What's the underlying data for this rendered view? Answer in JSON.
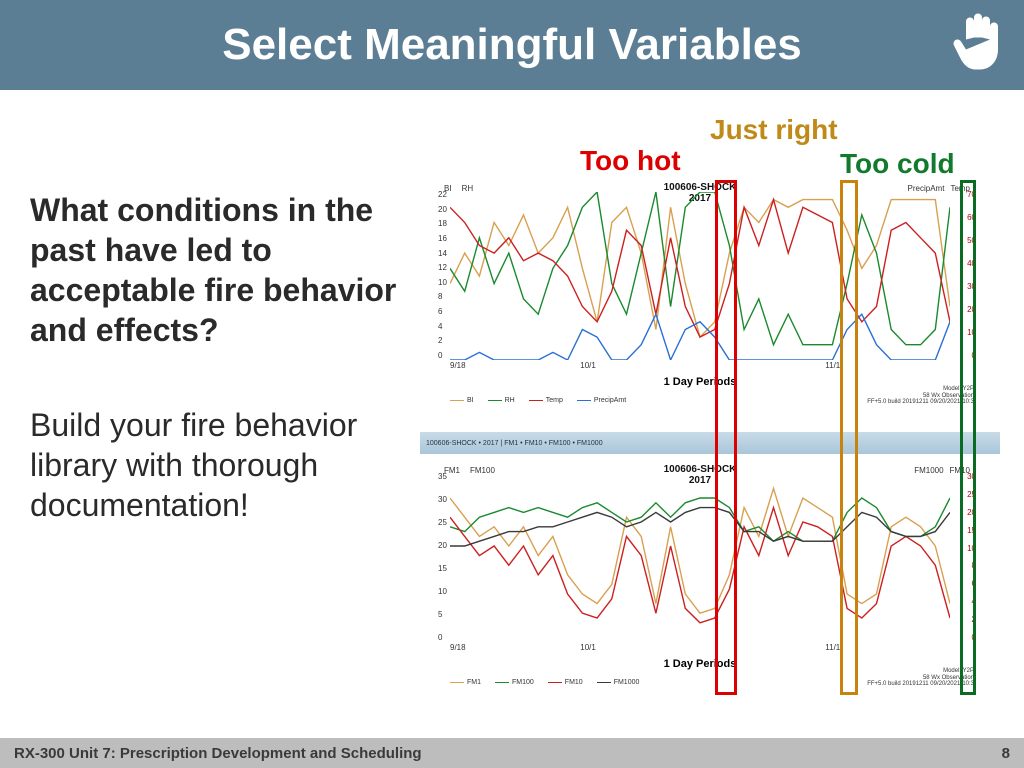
{
  "header": {
    "title": "Select Meaningful Variables"
  },
  "text": {
    "question": "What conditions in the past have led to acceptable fire behavior and effects?",
    "instruction": "Build your fire behavior library with thorough documentation!"
  },
  "labels": {
    "hot": "Too hot",
    "right": "Just right",
    "cold": "Too cold"
  },
  "chart": {
    "title": "100606-SHOCK",
    "subtitle": "2017",
    "periods": "1 Day Periods",
    "meta_model": "Model: Y2P",
    "meta_obs": "58 Wx Observation",
    "meta_build": "FF+5.0 build 20191211 09/20/2021-10:3",
    "bar_text": "100606-SHOCK • 2017 | FM1 • FM10 • FM100 • FM1000"
  },
  "footer": {
    "unit": "RX-300 Unit 7: Prescription Development and Scheduling",
    "page": "8"
  },
  "chart_data": [
    {
      "type": "line",
      "title": "100606-SHOCK 2017",
      "xlabel": "1 Day Periods",
      "x_ticks": [
        "9/18",
        "10/1",
        "11/1"
      ],
      "axes_left": {
        "labels": [
          "BI",
          "RH"
        ],
        "range": [
          0,
          22
        ],
        "ticks": [
          0,
          2,
          4,
          6,
          8,
          10,
          12,
          14,
          16,
          18,
          20,
          22
        ]
      },
      "axes_right": {
        "labels": [
          "PrecipAmt",
          "Temp"
        ],
        "range": [
          0,
          70
        ],
        "ticks": [
          0,
          10,
          20,
          30,
          40,
          50,
          60,
          70
        ]
      },
      "series": [
        {
          "name": "BI",
          "color": "#d8a050",
          "values": [
            10,
            14,
            11,
            18,
            15,
            19,
            14,
            16,
            20,
            12,
            5,
            18,
            20,
            14,
            4,
            20,
            10,
            3,
            5,
            14,
            20,
            18,
            21,
            20,
            21,
            21,
            21,
            17,
            12,
            15,
            21,
            21,
            21,
            21,
            7
          ]
        },
        {
          "name": "RH",
          "color": "#1a8a2e",
          "values": [
            12,
            9,
            16,
            10,
            14,
            8,
            6,
            12,
            15,
            20,
            22,
            10,
            6,
            14,
            22,
            7,
            20,
            22,
            22,
            15,
            4,
            8,
            2,
            6,
            2,
            2,
            2,
            10,
            19,
            14,
            4,
            2,
            2,
            4,
            20
          ]
        },
        {
          "name": "Temp",
          "color": "#cc2020",
          "values": [
            20,
            18,
            15,
            14,
            16,
            13,
            14,
            13,
            11,
            7,
            5,
            9,
            17,
            15,
            6,
            16,
            7,
            3,
            4,
            10,
            20,
            15,
            21,
            14,
            20,
            19,
            18,
            8,
            5,
            7,
            17,
            18,
            16,
            14,
            5
          ]
        },
        {
          "name": "PrecipAmt",
          "color": "#2a6fd6",
          "values": [
            0,
            0,
            1,
            0,
            0,
            0,
            0,
            1,
            0,
            4,
            3,
            0,
            0,
            2,
            6,
            0,
            4,
            5,
            3,
            0,
            0,
            0,
            0,
            0,
            0,
            0,
            0,
            4,
            6,
            2,
            0,
            0,
            0,
            0,
            5
          ]
        }
      ]
    },
    {
      "type": "line",
      "title": "100606-SHOCK 2017",
      "xlabel": "1 Day Periods",
      "x_ticks": [
        "9/18",
        "10/1",
        "11/1"
      ],
      "axes_left": {
        "labels": [
          "FM1",
          "FM100"
        ],
        "range": [
          0,
          35
        ],
        "ticks": [
          0,
          5,
          10,
          15,
          20,
          25,
          30,
          35
        ]
      },
      "axes_right": {
        "labels": [
          "FM1000",
          "FM10"
        ],
        "range": [
          0,
          30
        ],
        "ticks": [
          0,
          2,
          4,
          6,
          8,
          10,
          15,
          20,
          25,
          30
        ]
      },
      "series": [
        {
          "name": "FM1",
          "color": "#d8a050",
          "values": [
            30,
            26,
            22,
            24,
            20,
            24,
            18,
            22,
            14,
            10,
            8,
            12,
            26,
            22,
            8,
            24,
            10,
            6,
            7,
            14,
            28,
            22,
            32,
            22,
            30,
            28,
            26,
            10,
            8,
            10,
            24,
            26,
            24,
            20,
            8
          ]
        },
        {
          "name": "FM100",
          "color": "#1a8a2e",
          "values": [
            24,
            23,
            26,
            27,
            28,
            27,
            28,
            27,
            26,
            28,
            29,
            27,
            25,
            26,
            29,
            26,
            29,
            30,
            30,
            28,
            23,
            24,
            21,
            23,
            21,
            21,
            21,
            27,
            30,
            28,
            23,
            22,
            22,
            24,
            30
          ]
        },
        {
          "name": "FM10",
          "color": "#cc2020",
          "values": [
            26,
            22,
            18,
            20,
            16,
            20,
            14,
            18,
            10,
            6,
            5,
            9,
            22,
            18,
            6,
            20,
            7,
            4,
            5,
            11,
            24,
            18,
            28,
            18,
            25,
            24,
            22,
            7,
            5,
            8,
            20,
            22,
            20,
            16,
            5
          ]
        },
        {
          "name": "FM1000",
          "color": "#3a3a3a",
          "values": [
            20,
            20,
            21,
            22,
            23,
            23,
            24,
            24,
            25,
            26,
            27,
            26,
            24,
            25,
            27,
            25,
            27,
            28,
            28,
            27,
            23,
            23,
            21,
            22,
            21,
            21,
            21,
            24,
            27,
            26,
            23,
            22,
            22,
            23,
            27
          ]
        }
      ]
    }
  ]
}
